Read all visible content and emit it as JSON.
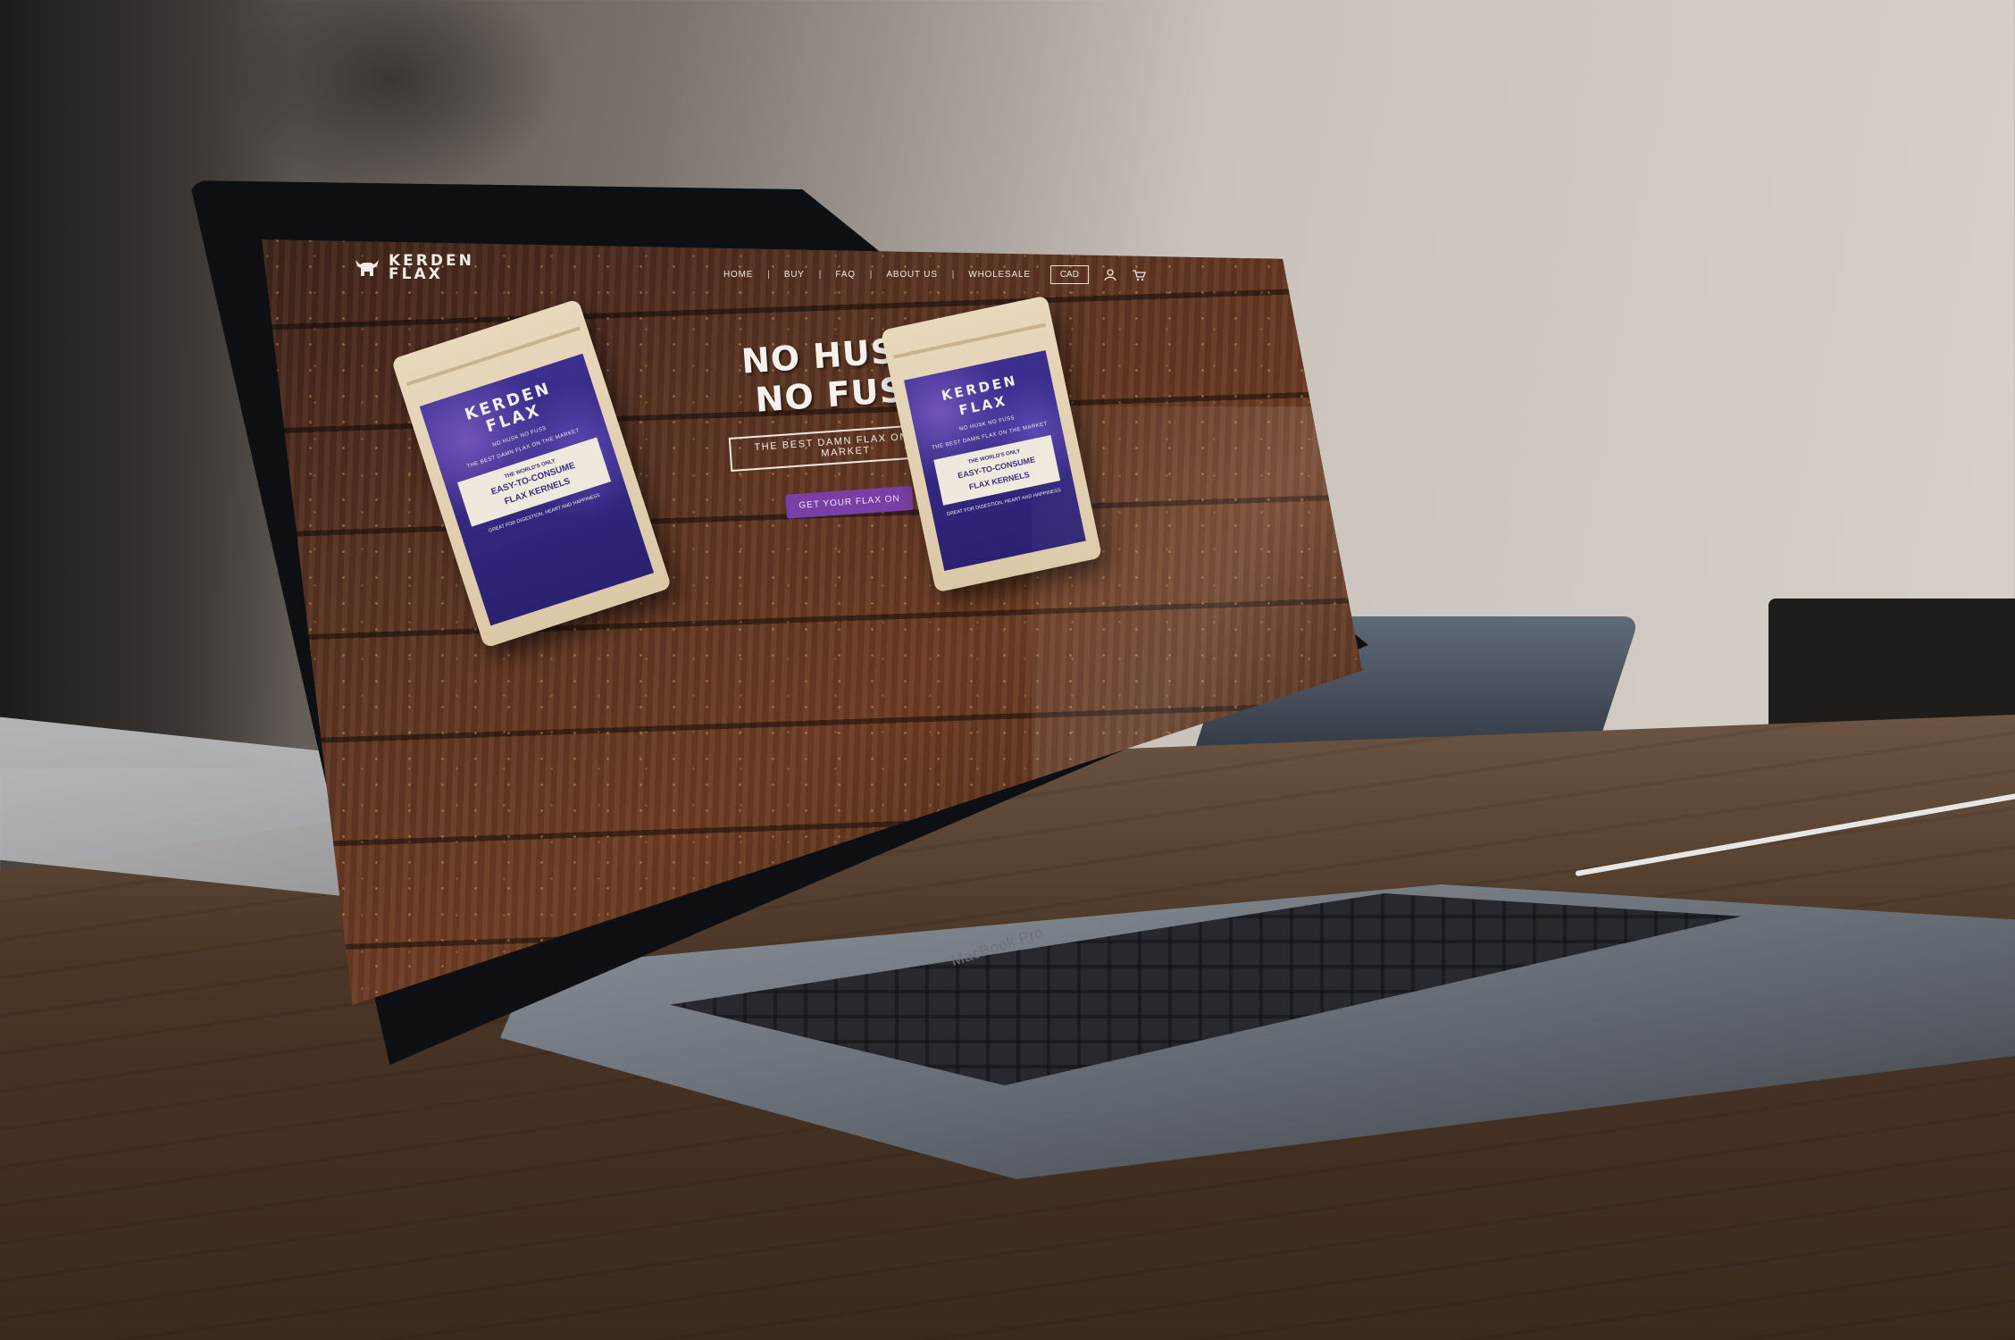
{
  "site": {
    "logo_text": "KERDEN FLAX",
    "nav": {
      "items": [
        "HOME",
        "BUY",
        "FAQ",
        "ABOUT US",
        "WHOLESALE"
      ],
      "currency": "CAD"
    },
    "hero": {
      "title_line1": "NO HUSK,",
      "title_line2": "NO FUSS",
      "tagline": "THE BEST DAMN FLAX ON THE MARKET",
      "cta": "GET YOUR FLAX ON"
    },
    "pouch": {
      "brand_line1": "KERDEN",
      "brand_line2": "FLAX",
      "sub": "NO HUSK  NO FUSS",
      "strap": "THE BEST DAMN FLAX ON THE MARKET",
      "box_small": "THE WORLD'S ONLY",
      "box_big_1": "EASY-TO-CONSUME",
      "box_big_2": "FLAX KERNELS",
      "foot": "GREAT FOR DIGESTION, HEART AND HAPPINESS"
    }
  },
  "device": {
    "brand": "MacBook Pro"
  },
  "colors": {
    "wood_dark": "#3b2219",
    "wood_mid": "#6b3b23",
    "pouch_purple": "#3c2f8e",
    "cta_purple": "#7a3fa6",
    "kraft": "#e8d8bc"
  },
  "icons": [
    "bull-logo-icon",
    "user-icon",
    "cart-icon"
  ]
}
